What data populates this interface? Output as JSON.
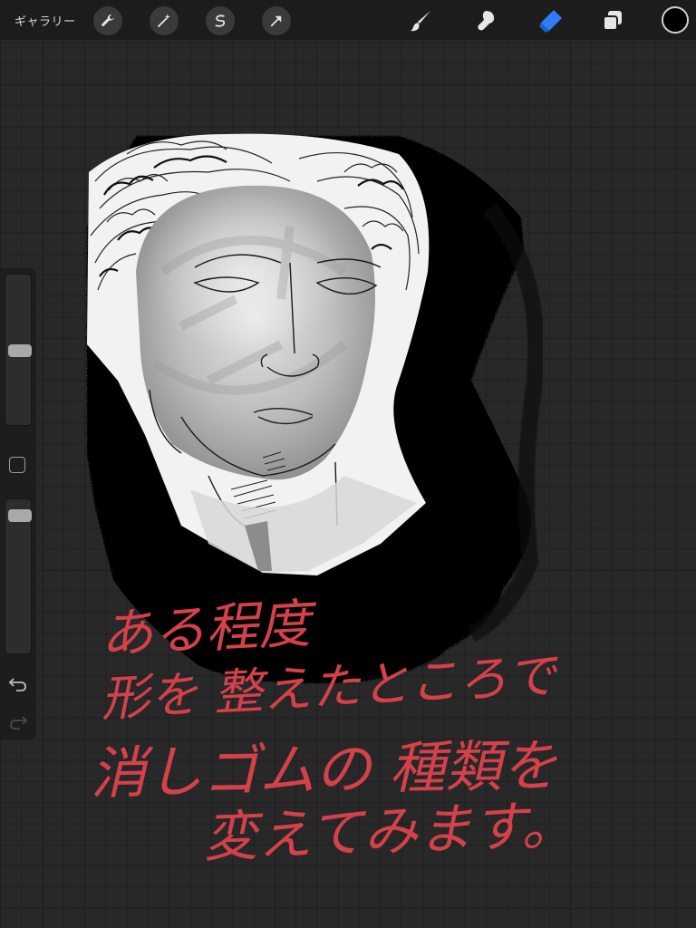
{
  "toolbar": {
    "gallery_label": "ギャラリー",
    "left_tools": [
      "wrench-icon",
      "magic-wand-icon",
      "selection-icon",
      "transform-icon"
    ],
    "right_tools": [
      "brush-icon",
      "smudge-icon",
      "eraser-icon",
      "layers-icon"
    ],
    "active_tool": "eraser-icon",
    "active_color": "#2f7df6",
    "current_color": "#000000"
  },
  "sidebar": {
    "brush_size_level": 0.5,
    "opacity_level": 0.95
  },
  "canvas": {
    "note_lines": [
      "ある程度",
      "形を 整えたところで",
      "消しゴムの 種類を",
      "変えてみます。"
    ],
    "note_color": "#d4414a"
  }
}
